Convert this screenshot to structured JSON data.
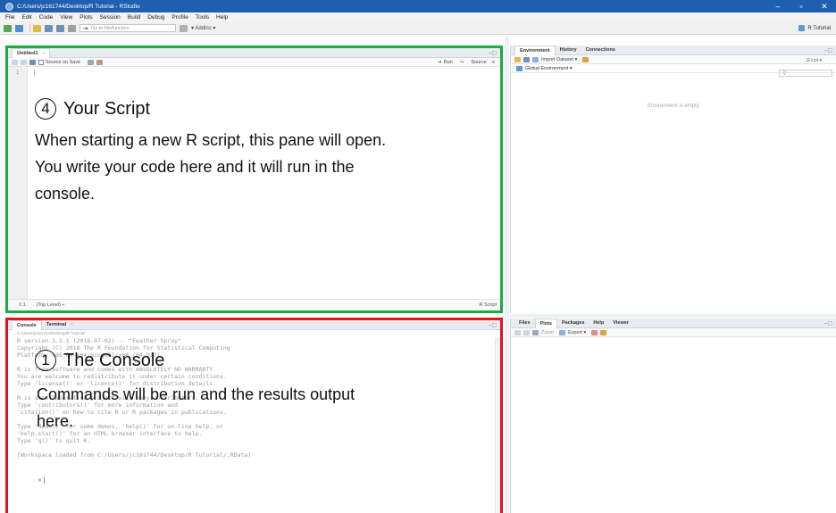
{
  "window": {
    "title": "C:/Users/jc161744/Desktop/R Tutorial - RStudio",
    "controls": [
      "–",
      "▫",
      "✕"
    ]
  },
  "menu": [
    "File",
    "Edit",
    "Code",
    "View",
    "Plots",
    "Session",
    "Build",
    "Debug",
    "Profile",
    "Tools",
    "Help"
  ],
  "toolbar": {
    "goto_placeholder": "Go to file/function",
    "addins_label": "▾ Addins ▾",
    "project_label": "R Tutorial"
  },
  "script_pane": {
    "tab_label": "Untitled1",
    "tab_close": "×",
    "source_on_save": "Source on Save",
    "run_label": "Run",
    "source_label": "Source",
    "line_number": "1",
    "status_pos": "1:1",
    "status_level": "(Top Level) ÷",
    "status_mode": "R Script",
    "annotation": {
      "number": "4",
      "title": "Your Script",
      "lines": [
        "When starting a new R script, this pane will open.",
        "You write your code here and it will run in the",
        "console."
      ]
    }
  },
  "console_pane": {
    "tabs": [
      {
        "label": "Console",
        "active": true
      },
      {
        "label": "Terminal",
        "close": "×",
        "active": false
      }
    ],
    "path": "C:/Users/jc161744/Desktop/R Tutorial/",
    "lines": [
      "R version 3.5.1 (2018-07-02) -- \"Feather Spray\"",
      "Copyright (C) 2018 The R Foundation for Statistical Computing",
      "Platform: x86_64-w64-mingw32/x64 (64-bit)",
      "",
      "R is free software and comes with ABSOLUTELY NO WARRANTY.",
      "You are welcome to redistribute it under certain conditions.",
      "Type 'license()' or 'licence()' for distribution details.",
      "",
      "R is a collaborative project with many contributors.",
      "Type 'contributors()' for more information and",
      "'citation()' on how to cite R or R packages in publications.",
      "",
      "Type 'demo()' for some demos, 'help()' for on-line help, or",
      "'help.start()' for an HTML browser interface to help.",
      "Type 'q()' to quit R.",
      "",
      "[Workspace loaded from C:/Users/jc161744/Desktop/R Tutorial/.RData]"
    ],
    "prompt": ">",
    "annotation": {
      "number": "1",
      "title": "The Console",
      "lines": [
        "Commands will be run and the results output",
        "here."
      ]
    }
  },
  "env_pane": {
    "tabs": [
      "Environment",
      "History",
      "Connections"
    ],
    "import_label": "Import Dataset ▾",
    "list_label": "☰ List ▾",
    "scope_label": "Global Environment ▾",
    "search_placeholder": "Q",
    "empty_message": "Environment is empty"
  },
  "files_pane": {
    "tabs": [
      "Files",
      "Plots",
      "Packages",
      "Help",
      "Viewer"
    ],
    "zoom_label": "Zoom",
    "export_label": "Export ▾"
  }
}
